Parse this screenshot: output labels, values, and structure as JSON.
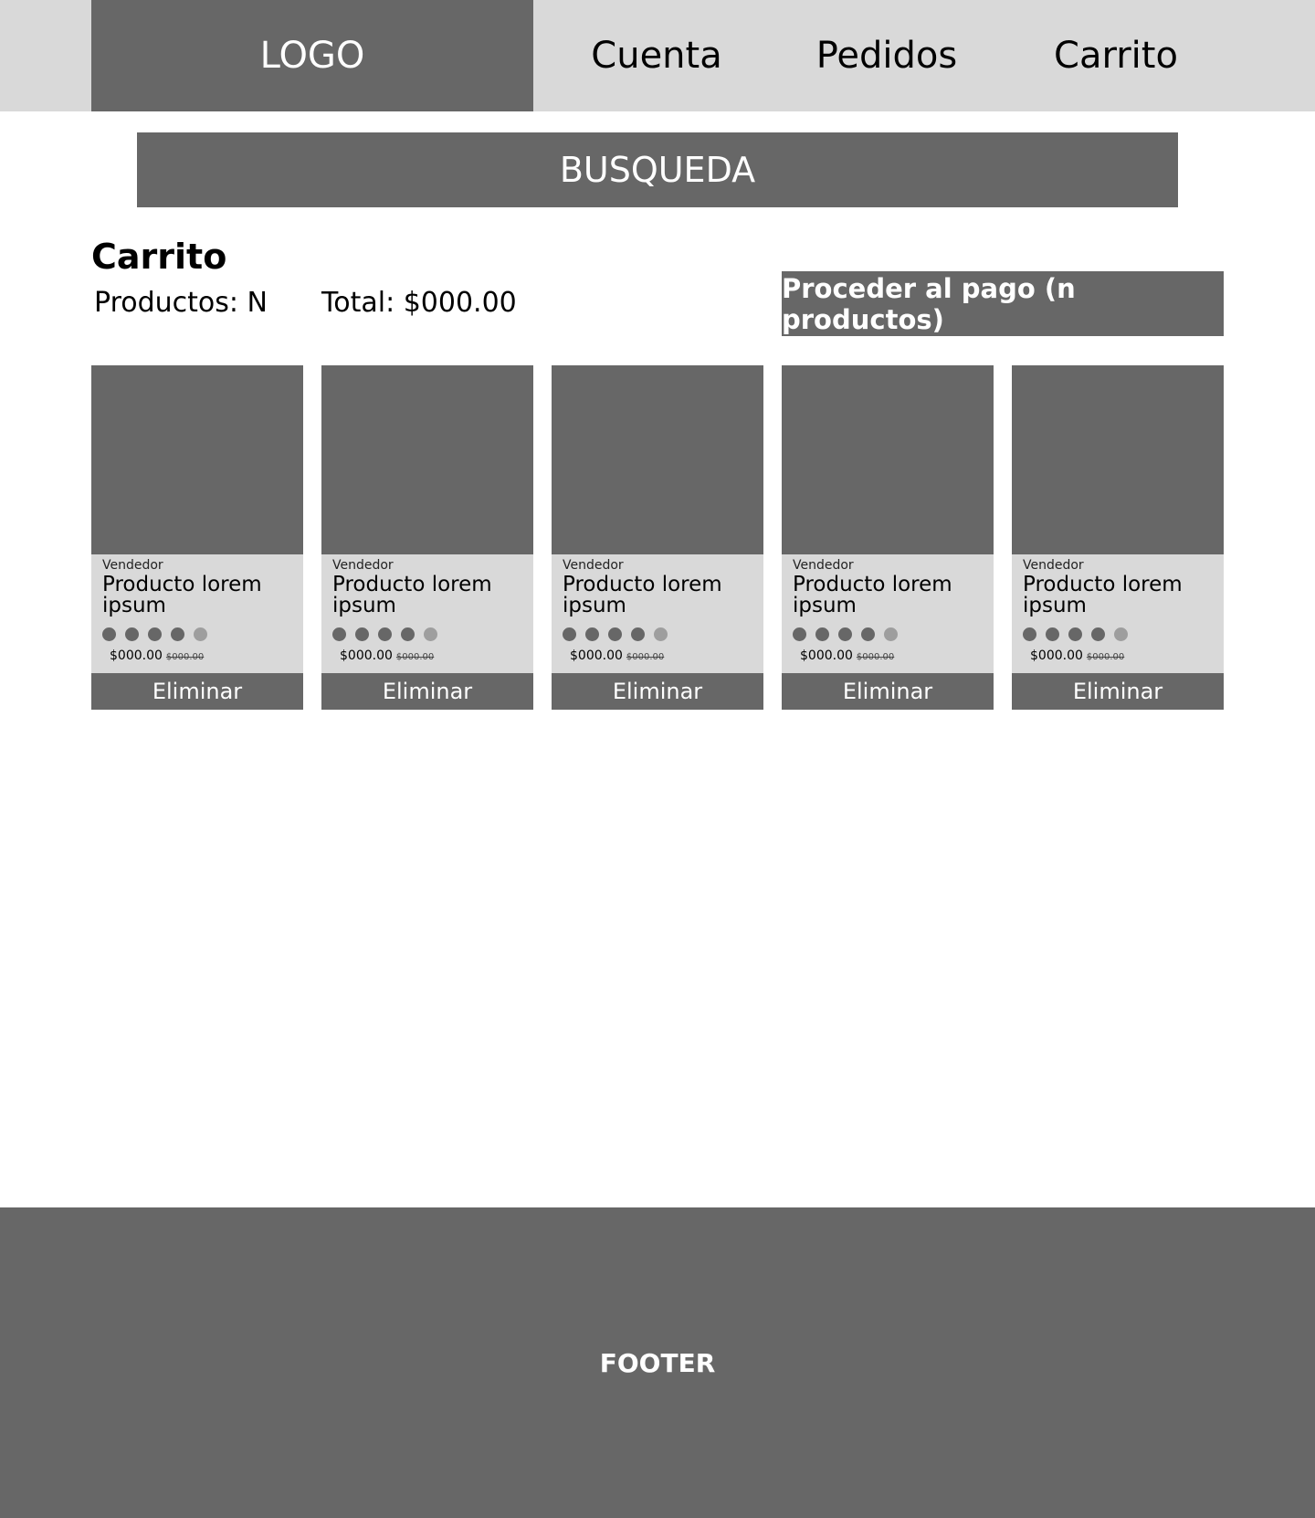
{
  "header": {
    "logo": "LOGO",
    "nav": [
      "Cuenta",
      "Pedidos",
      "Carrito"
    ]
  },
  "search": {
    "label": "BUSQUEDA"
  },
  "cart": {
    "title": "Carrito",
    "products_count": "Productos: N",
    "total": "Total: $000.00",
    "checkout_label": "Proceder al pago (n productos)"
  },
  "products": [
    {
      "vendor": "Vendedor",
      "name": "Producto lorem ipsum",
      "rating": 4,
      "rating_max": 5,
      "price": "$000.00",
      "old_price": "$000.00",
      "remove_label": "Eliminar"
    },
    {
      "vendor": "Vendedor",
      "name": "Producto lorem ipsum",
      "rating": 4,
      "rating_max": 5,
      "price": "$000.00",
      "old_price": "$000.00",
      "remove_label": "Eliminar"
    },
    {
      "vendor": "Vendedor",
      "name": "Producto lorem ipsum",
      "rating": 4,
      "rating_max": 5,
      "price": "$000.00",
      "old_price": "$000.00",
      "remove_label": "Eliminar"
    },
    {
      "vendor": "Vendedor",
      "name": "Producto lorem ipsum",
      "rating": 4,
      "rating_max": 5,
      "price": "$000.00",
      "old_price": "$000.00",
      "remove_label": "Eliminar"
    },
    {
      "vendor": "Vendedor",
      "name": "Producto lorem ipsum",
      "rating": 4,
      "rating_max": 5,
      "price": "$000.00",
      "old_price": "$000.00",
      "remove_label": "Eliminar"
    }
  ],
  "footer": {
    "label": "FOOTER"
  },
  "colors": {
    "dark_gray": "#676767",
    "light_gray": "#d9d9d9",
    "rating_off": "#9e9e9e"
  }
}
